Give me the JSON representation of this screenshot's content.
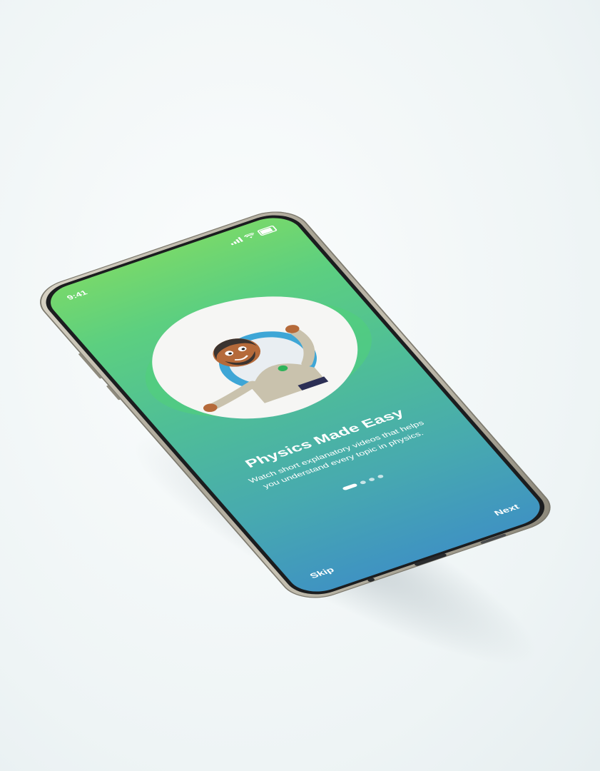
{
  "status_bar": {
    "time": "9:41"
  },
  "onboarding": {
    "title": "Physics Made Easy",
    "description": "Watch short explanatory videos that helps you understand every topic in physics.",
    "page_count": 4,
    "active_page": 1
  },
  "nav": {
    "skip_label": "Skip",
    "next_label": "Next"
  },
  "colors": {
    "gradient_top": "#76d86c",
    "gradient_bottom": "#3f93c2",
    "blob": "#f6f6f4",
    "accent_ring": "#3ea6d6"
  },
  "icons": [
    "signal-icon",
    "wifi-icon",
    "battery-icon"
  ]
}
